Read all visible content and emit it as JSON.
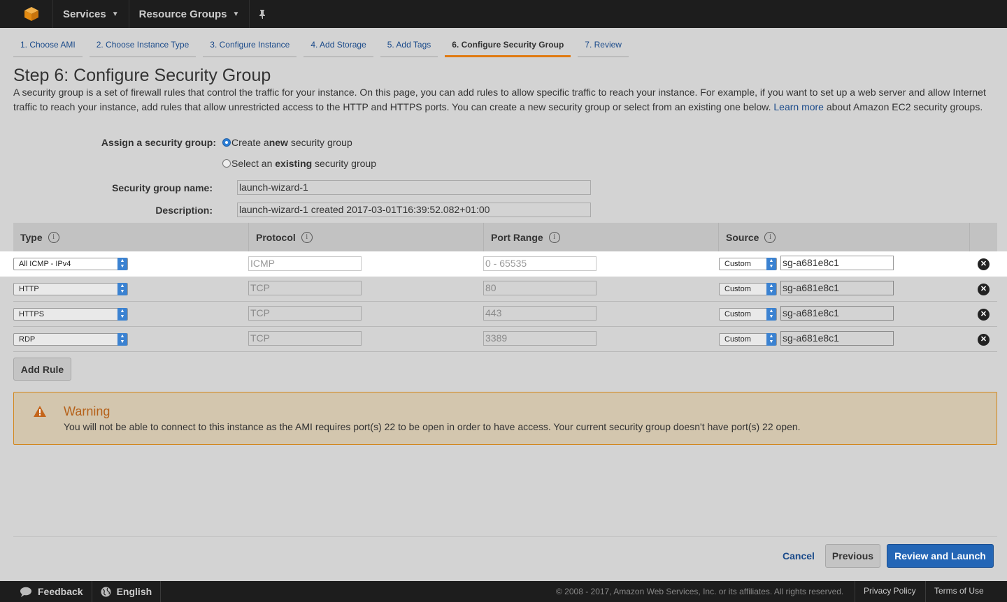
{
  "topnav": {
    "services_label": "Services",
    "resource_groups_label": "Resource Groups",
    "brand_color": "#ff9900"
  },
  "wizard_tabs": [
    {
      "label": "1. Choose AMI"
    },
    {
      "label": "2. Choose Instance Type"
    },
    {
      "label": "3. Configure Instance"
    },
    {
      "label": "4. Add Storage"
    },
    {
      "label": "5. Add Tags"
    },
    {
      "label": "6. Configure Security Group",
      "active": true
    },
    {
      "label": "7. Review"
    }
  ],
  "page": {
    "title": "Step 6: Configure Security Group",
    "intro_before_link": "A security group is a set of firewall rules that control the traffic for your instance. On this page, you can add rules to allow specific traffic to reach your instance. For example, if you want to set up a web server and allow Internet traffic to reach your instance, add rules that allow unrestricted access to the HTTP and HTTPS ports. You can create a new security group or select from an existing one below.",
    "intro_link": "Learn more",
    "intro_after_link": "about Amazon EC2 security groups."
  },
  "assign": {
    "label": "Assign a security group:",
    "option_new_pre": "Create a ",
    "option_new_bold": "new",
    "option_new_post": " security group",
    "option_existing_pre": "Select an ",
    "option_existing_bold": "existing",
    "option_existing_post": " security group",
    "selected": "new"
  },
  "group_name": {
    "label": "Security group name:",
    "value": "launch-wizard-1"
  },
  "description": {
    "label": "Description:",
    "value": "launch-wizard-1 created 2017-03-01T16:39:52.082+01:00"
  },
  "table": {
    "headers": {
      "type": "Type",
      "protocol": "Protocol",
      "port_range": "Port Range",
      "source": "Source"
    },
    "rows": [
      {
        "type": "All ICMP - IPv4",
        "protocol": "ICMP",
        "port": "0 - 65535",
        "source_type": "Custom",
        "source": "sg-a681e8c1"
      },
      {
        "type": "HTTP",
        "protocol": "TCP",
        "port": "80",
        "source_type": "Custom",
        "source": "sg-a681e8c1"
      },
      {
        "type": "HTTPS",
        "protocol": "TCP",
        "port": "443",
        "source_type": "Custom",
        "source": "sg-a681e8c1"
      },
      {
        "type": "RDP",
        "protocol": "TCP",
        "port": "3389",
        "source_type": "Custom",
        "source": "sg-a681e8c1"
      }
    ]
  },
  "add_rule_label": "Add Rule",
  "warning": {
    "title": "Warning",
    "text": "You will not be able to connect to this instance as the AMI requires port(s) 22 to be open in order to have access. Your current security group doesn't have port(s) 22 open."
  },
  "actions": {
    "cancel": "Cancel",
    "previous": "Previous",
    "review_launch": "Review and Launch"
  },
  "bottombar": {
    "feedback": "Feedback",
    "language": "English",
    "copyright": "© 2008 - 2017, Amazon Web Services, Inc. or its affiliates. All rights reserved.",
    "privacy": "Privacy Policy",
    "terms": "Terms of Use"
  }
}
